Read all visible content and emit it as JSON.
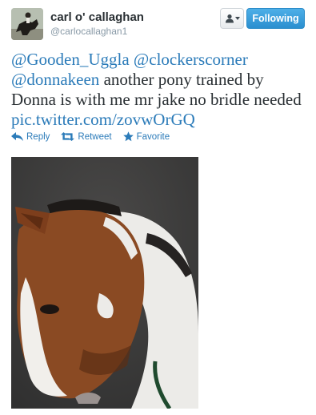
{
  "user": {
    "name": "carl o' callaghan",
    "handle": "@carlocallaghan1"
  },
  "header": {
    "following_label": "Following",
    "user_menu_icon": "person-icon"
  },
  "tweet": {
    "mentions": [
      "@Gooden_Uggla",
      "@clockerscorner",
      "@donnakeen"
    ],
    "body": "another pony trained by Donna is with me mr jake no bridle needed",
    "link": "pic.twitter.com/zovwOrGQ"
  },
  "actions": {
    "reply_label": "Reply",
    "retweet_label": "Retweet",
    "favorite_label": "Favorite"
  },
  "colors": {
    "link": "#2b7bb9",
    "follow_button": "#2b8fd0",
    "text": "#292f33",
    "muted": "#8899a6"
  }
}
